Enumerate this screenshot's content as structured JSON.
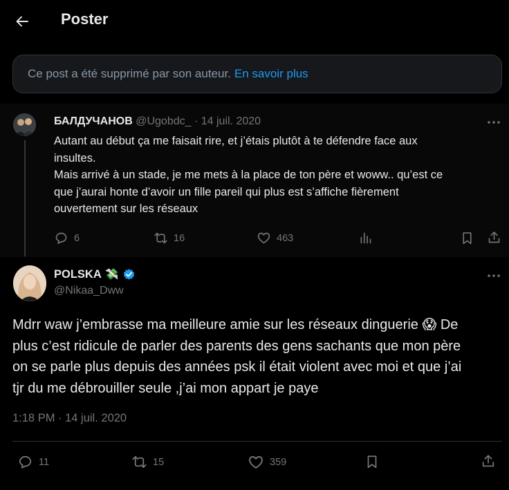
{
  "header": {
    "title": "Poster"
  },
  "deleted_notice": {
    "text": "Ce post a été supprimé par son auteur.",
    "link": "En savoir plus"
  },
  "reply": {
    "name": "БАЛДУЧАНОВ",
    "handle": "@Ugobdc_",
    "date": "· 14 juil. 2020",
    "text_lines": [
      "Autant au début ça me faisait rire, et j’étais plutôt à te défendre face aux",
      "insultes.",
      "Mais arrivé à un stade, je me mets à la place de ton père et woww.. qu’est ce",
      "que j’aurai honte d’avoir un fille pareil qui plus est s’affiche fièrement",
      "ouvertement sur les réseaux"
    ],
    "replies": "6",
    "reposts": "16",
    "likes": "463"
  },
  "main": {
    "name": "POLSKA",
    "name_emoji": "💸",
    "handle": "@Nikaa_Dww",
    "text_lines": [
      "Mdrr waw j’embrasse ma meilleure amie sur les réseaux dinguerie 😱 De",
      "plus c’est ridicule de parler des parents des gens sachants que mon père",
      "on se parle plus depuis des années psk il était violent avec moi et que j’ai",
      "tjr du me débrouiller seule ,j’ai mon appart je paye"
    ],
    "time": "1:18 PM · 14 juil. 2020",
    "replies": "11",
    "reposts": "15",
    "likes": "359"
  },
  "colors": {
    "accent": "#1d9bf0",
    "muted": "#71767b",
    "text": "#e7e9ea"
  }
}
